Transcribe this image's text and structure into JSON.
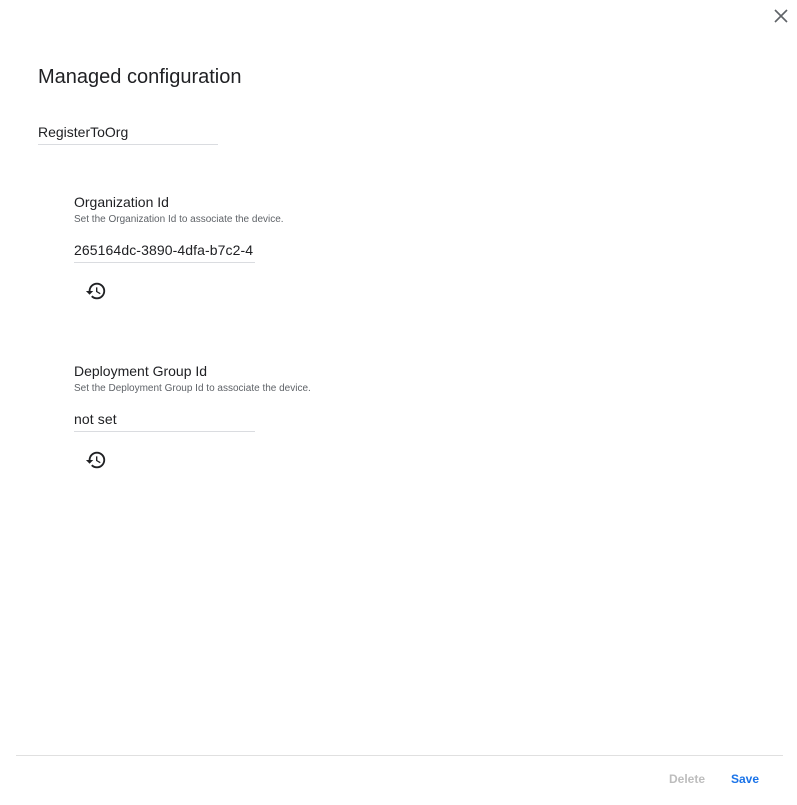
{
  "dialog": {
    "title": "Managed configuration",
    "close_icon": "close-icon"
  },
  "config_name": {
    "value": "RegisterToOrg"
  },
  "settings": [
    {
      "label": "Organization Id",
      "description": "Set the Organization Id to associate the device.",
      "value": "265164dc-3890-4dfa-b7c2-4",
      "reset_icon": "history-icon"
    },
    {
      "label": "Deployment Group Id",
      "description": "Set the Deployment Group Id to associate the device.",
      "value": "not set",
      "reset_icon": "history-icon"
    }
  ],
  "footer": {
    "delete_label": "Delete",
    "save_label": "Save"
  },
  "colors": {
    "accent": "#1a73e8",
    "disabled": "#bdbdbd",
    "divider": "#dadce0"
  }
}
